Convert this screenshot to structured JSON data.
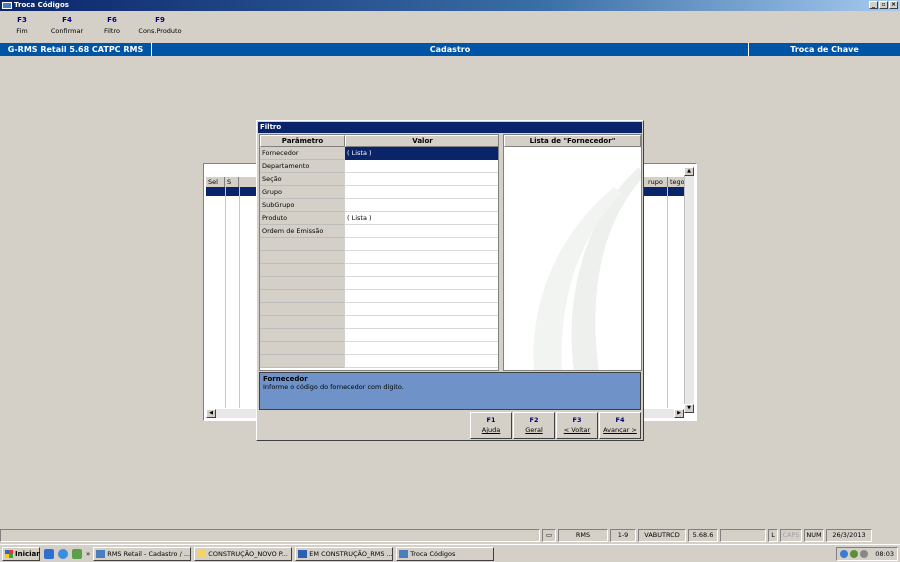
{
  "window": {
    "title": "Troca Códigos"
  },
  "fkeys": [
    {
      "key": "F3",
      "label": "Fim"
    },
    {
      "key": "F4",
      "label": "Confirmar"
    },
    {
      "key": "F6",
      "label": "Filtro"
    },
    {
      "key": "F9",
      "label": "Cons.Produto"
    }
  ],
  "header": {
    "app": "G-RMS Retail 5.68 CATPC RMS",
    "module": "Cadastro",
    "screen": "Troca de Chave"
  },
  "bg_grid": {
    "headers": [
      "Sel",
      "S",
      "rupo",
      "tego"
    ]
  },
  "dialog": {
    "title": "Filtro",
    "col_param": "Parâmetro",
    "col_value": "Valor",
    "rows": [
      {
        "name": "Fornecedor",
        "value": "( Lista )",
        "selected": true
      },
      {
        "name": "Departamento",
        "value": ""
      },
      {
        "name": "Seção",
        "value": ""
      },
      {
        "name": "Grupo",
        "value": ""
      },
      {
        "name": "SubGrupo",
        "value": ""
      },
      {
        "name": "Produto",
        "value": "( Lista )"
      },
      {
        "name": "Ordem de Emissão",
        "value": ""
      }
    ],
    "list_title": "Lista de \"Fornecedor\"",
    "help_title": "Fornecedor",
    "help_text": "Informe o código do fornecedor com dígito.",
    "buttons": [
      {
        "key": "F1",
        "label": "Ajuda"
      },
      {
        "key": "F2",
        "label": "Geral"
      },
      {
        "key": "F3",
        "label": "< Voltar"
      },
      {
        "key": "F4",
        "label": "Avançar >"
      }
    ]
  },
  "status": {
    "cells": [
      "RMS",
      "1-9",
      "VABUTRCD",
      "5.68.6",
      "",
      "L",
      "CAPS",
      "NUM",
      "26/3/2013"
    ]
  },
  "taskbar": {
    "start": "Iniciar",
    "items": [
      "RMS Retail - Cadastro / ...",
      "CONSTRUÇÃO_NOVO P...",
      "EM CONSTRUÇÃO_RMS ...",
      "Troca Códigos"
    ],
    "clock": "08:03"
  },
  "colors": {
    "header_blue": "#0054a6",
    "selection": "#0a246a",
    "help_bg": "#6f93c9",
    "fkey_blue": "#000080"
  }
}
